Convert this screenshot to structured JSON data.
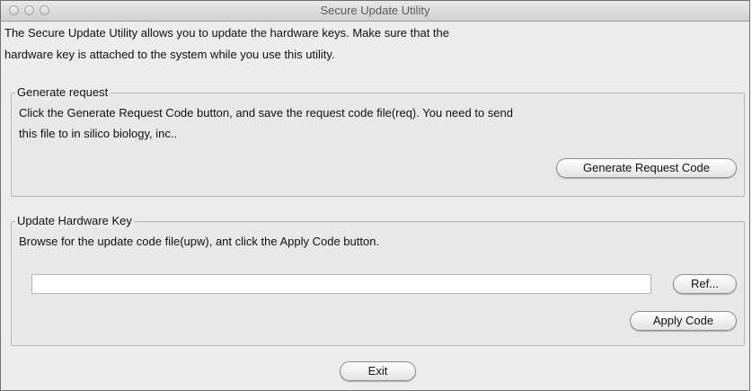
{
  "window": {
    "title": "Secure Update Utility"
  },
  "intro": {
    "line1": "The Secure Update Utility allows you to update the hardware keys. Make sure that the",
    "line2": "hardware key is attached to the system while you use this utility."
  },
  "generate_group": {
    "legend": "Generate request",
    "line1": "Click the Generate Request Code button, and save the request code file(req). You need to send",
    "line2": "this file to in silico biology, inc..",
    "button_label": "Generate Request Code"
  },
  "update_group": {
    "legend": "Update Hardware Key",
    "instruction": "Browse for the update code file(upw), ant click the Apply Code button.",
    "file_path_value": "",
    "ref_button_label": "Ref...",
    "apply_button_label": "Apply Code"
  },
  "footer": {
    "exit_button_label": "Exit"
  }
}
